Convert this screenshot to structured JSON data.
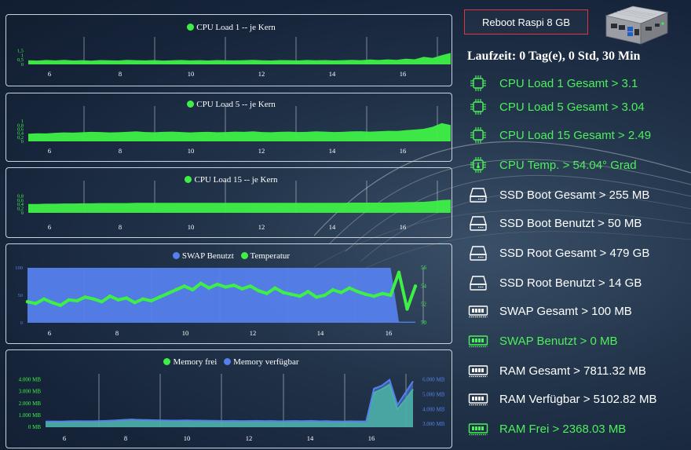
{
  "colors": {
    "green": "#3ef046",
    "blue": "#5580ec",
    "panel_border": "#c9d3de"
  },
  "reboot_button": "Reboot Raspi 8 GB",
  "uptime": "Laufzeit: 0 Tag(e), 0 Std, 30 Min",
  "stats": [
    {
      "label": "CPU Load 1 Gesamt > 3.1",
      "icon": "cpu-chip-icon",
      "color": "green"
    },
    {
      "label": "CPU Load 5 Gesamt > 3.04",
      "icon": "cpu-chip-icon",
      "color": "green"
    },
    {
      "label": "CPU Load 15 Gesamt > 2.49",
      "icon": "cpu-chip-icon",
      "color": "green"
    },
    {
      "label": "CPU Temp. > 54.04° Grad",
      "icon": "cpu-temperature-icon",
      "color": "green"
    },
    {
      "label": "SSD Boot Gesamt > 255 MB",
      "icon": "hard-drive-icon",
      "color": "white"
    },
    {
      "label": "SSD Boot Benutzt > 50 MB",
      "icon": "hard-drive-icon",
      "color": "white"
    },
    {
      "label": "SSD Root Gesamt > 479 GB",
      "icon": "hard-drive-icon",
      "color": "white"
    },
    {
      "label": "SSD Root Benutzt > 14 GB",
      "icon": "hard-drive-icon",
      "color": "white"
    },
    {
      "label": "SWAP Gesamt > 100 MB",
      "icon": "memory-module-icon",
      "color": "white"
    },
    {
      "label": "SWAP Benutzt > 0 MB",
      "icon": "memory-module-icon",
      "color": "green"
    },
    {
      "label": "RAM Gesamt > 7811.32 MB",
      "icon": "memory-module-icon",
      "color": "white"
    },
    {
      "label": "RAM Verfügbar > 5102.82 MB",
      "icon": "memory-module-icon",
      "color": "white"
    },
    {
      "label": "RAM Frei > 2368.03 MB",
      "icon": "memory-module-icon",
      "color": "green"
    }
  ],
  "chart_data": [
    {
      "type": "area",
      "x_ticks": [
        "6",
        "8",
        "10",
        "12",
        "14",
        "16"
      ],
      "y_ticks": [
        "0",
        "0,5",
        "1",
        "1,5"
      ],
      "ylim": [
        0,
        1.8
      ],
      "series": [
        {
          "name": "CPU Load 1 -- je Kern",
          "color": "green",
          "values": [
            0.45,
            0.42,
            0.48,
            0.44,
            0.5,
            0.43,
            0.46,
            0.41,
            0.47,
            0.45,
            0.43,
            0.49,
            0.46,
            0.44,
            0.47,
            0.42,
            0.45,
            0.48,
            0.44,
            0.46,
            0.43,
            0.47,
            0.45,
            0.44,
            0.46,
            0.49,
            0.45,
            0.43,
            0.47,
            0.46,
            0.44,
            0.48,
            0.45,
            0.47,
            0.44,
            0.46,
            0.5,
            0.46,
            0.53,
            0.48,
            0.55,
            0.5,
            0.62,
            0.56,
            0.82,
            0.7,
            1.0,
            1.25
          ]
        }
      ]
    },
    {
      "type": "area",
      "x_ticks": [
        "6",
        "8",
        "10",
        "12",
        "14",
        "16"
      ],
      "y_ticks": [
        "0",
        "0,2",
        "0,4",
        "0,6",
        "0,8",
        "1"
      ],
      "ylim": [
        0,
        1.2
      ],
      "series": [
        {
          "name": "CPU Load 5 -- je Kern",
          "color": "green",
          "values": [
            0.38,
            0.4,
            0.39,
            0.42,
            0.44,
            0.43,
            0.45,
            0.47,
            0.46,
            0.44,
            0.45,
            0.47,
            0.49,
            0.46,
            0.45,
            0.47,
            0.48,
            0.46,
            0.44,
            0.46,
            0.47,
            0.45,
            0.46,
            0.48,
            0.47,
            0.49,
            0.46,
            0.45,
            0.47,
            0.48,
            0.46,
            0.47,
            0.49,
            0.48,
            0.46,
            0.47,
            0.49,
            0.5,
            0.48,
            0.5,
            0.52,
            0.51,
            0.55,
            0.58,
            0.62,
            0.72,
            0.9,
            0.8
          ]
        }
      ]
    },
    {
      "type": "area",
      "x_ticks": [
        "6",
        "8",
        "10",
        "12",
        "14",
        "16"
      ],
      "y_ticks": [
        "0",
        "0,2",
        "0,4",
        "0,6",
        "0,8"
      ],
      "ylim": [
        0,
        1.0
      ],
      "series": [
        {
          "name": "CPU Load 15 -- je Kern",
          "color": "green",
          "values": [
            0.42,
            0.42,
            0.43,
            0.43,
            0.44,
            0.44,
            0.45,
            0.45,
            0.46,
            0.46,
            0.46,
            0.46,
            0.47,
            0.47,
            0.47,
            0.47,
            0.47,
            0.47,
            0.47,
            0.47,
            0.47,
            0.47,
            0.47,
            0.47,
            0.47,
            0.47,
            0.47,
            0.47,
            0.47,
            0.47,
            0.47,
            0.47,
            0.47,
            0.47,
            0.47,
            0.47,
            0.48,
            0.48,
            0.48,
            0.48,
            0.48,
            0.49,
            0.5,
            0.51,
            0.52,
            0.55,
            0.6,
            0.62
          ]
        }
      ]
    },
    {
      "type": "line",
      "x_ticks": [
        "6",
        "8",
        "10",
        "12",
        "14",
        "16"
      ],
      "y_ticks_left": [
        "0",
        "50",
        "100"
      ],
      "y_ticks_right": [
        "50",
        "52",
        "54",
        "56"
      ],
      "ylim_left": [
        0,
        100
      ],
      "ylim_right": [
        50,
        56
      ],
      "series": [
        {
          "name": "SWAP Benutzt",
          "color": "blue",
          "axis": "left",
          "values": [
            100,
            100,
            100,
            100,
            100,
            100,
            100,
            100,
            100,
            100,
            100,
            100,
            100,
            100,
            100,
            100,
            100,
            100,
            100,
            100,
            100,
            100,
            100,
            100,
            100,
            100,
            100,
            100,
            100,
            100,
            100,
            100,
            100,
            100,
            100,
            100,
            100,
            100,
            100,
            100,
            100,
            100,
            100,
            100,
            100,
            2,
            2,
            2
          ]
        },
        {
          "name": "Temperatur",
          "color": "green",
          "axis": "right",
          "values": [
            52.3,
            52.1,
            52.6,
            52.2,
            51.9,
            52.5,
            52.4,
            52.8,
            52.6,
            52.3,
            52.9,
            52.5,
            52.7,
            52.2,
            52.6,
            52.4,
            52.8,
            53.2,
            53.6,
            54.0,
            53.6,
            54.3,
            53.8,
            54.2,
            53.9,
            54.1,
            53.7,
            54.0,
            53.5,
            53.2,
            53.8,
            53.3,
            53.1,
            52.9,
            53.4,
            52.8,
            53.0,
            53.6,
            53.3,
            53.8,
            53.4,
            53.1,
            52.9,
            53.2,
            53.0,
            55.5,
            51.5,
            54.0
          ]
        }
      ]
    },
    {
      "type": "line",
      "x_ticks": [
        "6",
        "8",
        "10",
        "12",
        "14",
        "16"
      ],
      "y_ticks_left": [
        "0 MB",
        "1.000 MB",
        "2.000 MB",
        "3.000 MB",
        "4.000 MB"
      ],
      "y_ticks_right": [
        "3.000 MB",
        "4.000 MB",
        "5.000 MB",
        "6.000 MB"
      ],
      "ylim_left": [
        0,
        4500
      ],
      "ylim_right": [
        2800,
        6400
      ],
      "series": [
        {
          "name": "Memory frei",
          "color": "green",
          "axis": "left",
          "values": [
            430,
            450,
            440,
            470,
            480,
            460,
            470,
            500,
            520,
            560,
            600,
            640,
            610,
            590,
            570,
            560,
            550,
            540,
            560,
            550,
            540,
            530,
            520,
            510,
            520,
            500,
            510,
            520,
            500,
            510,
            490,
            500,
            510,
            500,
            520,
            490,
            500,
            480,
            470,
            490,
            480,
            470,
            2900,
            3200,
            3600,
            1500,
            2300,
            3200
          ]
        },
        {
          "name": "Memory verfügbar",
          "color": "blue",
          "axis": "right",
          "values": [
            3180,
            3190,
            3180,
            3200,
            3210,
            3200,
            3200,
            3220,
            3240,
            3260,
            3300,
            3320,
            3300,
            3290,
            3270,
            3260,
            3250,
            3250,
            3260,
            3250,
            3240,
            3240,
            3230,
            3220,
            3230,
            3210,
            3220,
            3230,
            3210,
            3220,
            3200,
            3210,
            3220,
            3210,
            3230,
            3200,
            3210,
            3190,
            3180,
            3200,
            3190,
            3180,
            5400,
            5600,
            6000,
            4300,
            5100,
            5900
          ]
        }
      ]
    }
  ]
}
